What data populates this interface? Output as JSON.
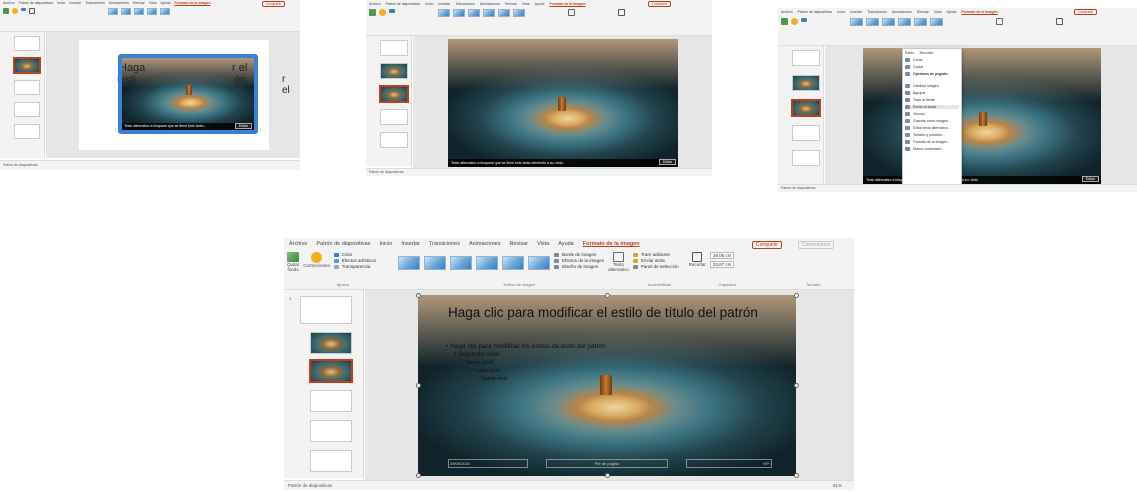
{
  "tabs": {
    "file": "Archivo",
    "slide_master": "Patrón de diapositivas",
    "home": "Inicio",
    "insert": "Insertar",
    "transitions": "Transiciones",
    "animations": "Animaciones",
    "review": "Revisar",
    "view": "Vista",
    "help": "Ayuda",
    "picture_format": "Formato de la imagen"
  },
  "share": {
    "share": "Compartir",
    "comments": "Comentarios"
  },
  "ribbon": {
    "remove_background": "Quitar\nfondo",
    "corrections": "Correcciones",
    "color": "Color",
    "artistic_effects": "Efectos artísticos",
    "transparency": "Transparencia",
    "picture_border": "Borde de imagen",
    "picture_effects": "Efectos de la imagen",
    "picture_layout": "Diseño de imagen",
    "alt_text": "Texto\nalternativo",
    "bring_forward": "Traer adelante",
    "send_backward": "Enviar atrás",
    "selection_pane": "Panel de selección",
    "crop": "Recortar",
    "height": "19,05 cm",
    "width": "33,87 cm",
    "group_adjust": "Ajustar",
    "group_styles": "Estilos de imagen",
    "group_accessibility": "Accesibilidad",
    "group_arrange": "Organizar",
    "group_size": "Tamaño"
  },
  "slide": {
    "title": "Haga clic para modificar el estilo de título del patrón",
    "body": "Haga clic para modificar los estilos de texto del patrón",
    "level2": "Segundo nivel",
    "level3": "Tercer nivel",
    "level4": "Cuarto nivel",
    "level5": "Quinto nivel",
    "footer_date": "29/05/2024",
    "footer_center": "Pie de página",
    "footer_num": "‹Nº›"
  },
  "alt_text_bar": {
    "text": "Texto alternativo a bloquear que se tiene todo tanto elemento a su. visto.",
    "edit": "Editar"
  },
  "panel1_overlay": {
    "title_a": "Haga",
    "title_b": "r el",
    "title_c": "esti",
    "title_d": "ón",
    "body": "Haga",
    "alt": "Texto alternativo a bloquear que se tiene todo tanto...",
    "edit": "Editar"
  },
  "context_menu": {
    "style": "Estilo",
    "crop": "Recortar",
    "items": [
      "Cortar",
      "Copiar",
      "Opciones de pegado:",
      "",
      "Cambiar imagen",
      "Agrupar",
      "Traer al frente",
      "Enviar al fondo",
      "Vínculo",
      "Guardar como imagen...",
      "Editar texto alternativo...",
      "Tamaño y posición...",
      "Formato de la imagen...",
      "Nuevo comentario"
    ]
  },
  "status": {
    "view": "Patrón de diapositivas",
    "zoom": "61%"
  },
  "colors": {
    "accent": "#c43e1c",
    "selection": "#3b7fd9"
  }
}
